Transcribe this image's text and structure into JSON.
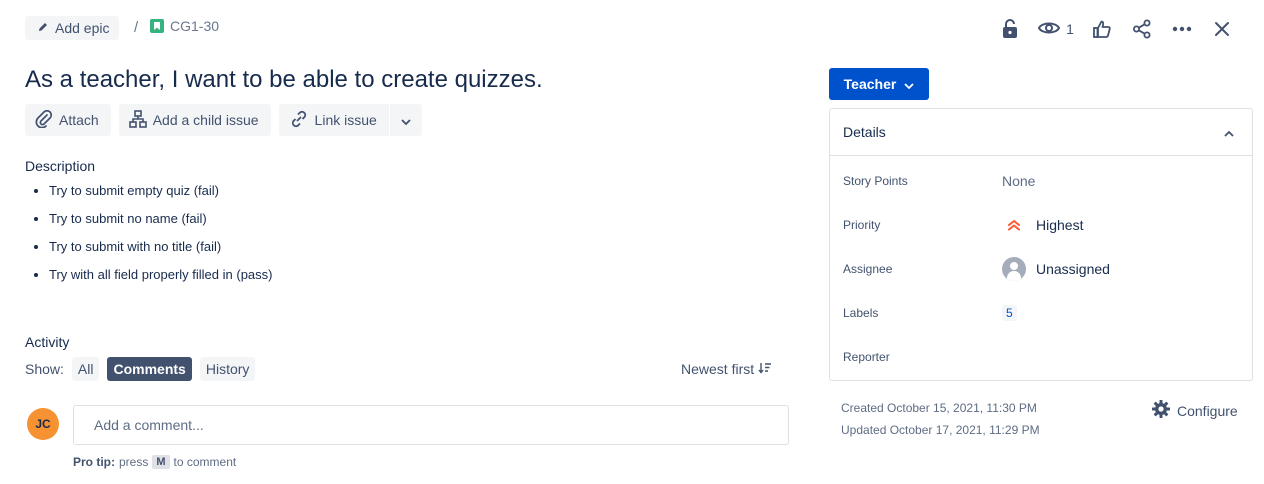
{
  "breadcrumb": {
    "epic_label": "Add epic",
    "separator": "/",
    "issue_key": "CG1-30"
  },
  "toolbar": {
    "watch_count": "1",
    "icons": [
      "unlock-icon",
      "eye-icon",
      "thumbs-up-icon",
      "share-icon",
      "more-icon",
      "close-icon"
    ]
  },
  "issue": {
    "title": "As a teacher, I want to be able to create quizzes."
  },
  "actions": {
    "attach": "Attach",
    "add_child": "Add a child issue",
    "link_issue": "Link issue"
  },
  "description": {
    "heading": "Description",
    "items": [
      "Try to submit empty quiz (fail)",
      "Try to submit no name (fail)",
      "Try to submit with no title (fail)",
      "Try with all field properly filled in (pass)"
    ]
  },
  "activity": {
    "heading": "Activity",
    "show_label": "Show:",
    "filters": [
      "All",
      "Comments",
      "History"
    ],
    "active_filter": "Comments",
    "sort_label": "Newest first",
    "avatar_initials": "JC",
    "comment_placeholder": "Add a comment...",
    "protip_prefix": "Pro tip:",
    "protip_press": "press",
    "protip_key": "M",
    "protip_suffix": "to comment"
  },
  "sidebar": {
    "status_label": "Teacher",
    "details_heading": "Details",
    "fields": {
      "story_points": {
        "label": "Story Points",
        "value": "None"
      },
      "priority": {
        "label": "Priority",
        "value": "Highest"
      },
      "assignee": {
        "label": "Assignee",
        "value": "Unassigned"
      },
      "labels": {
        "label": "Labels",
        "value": "5"
      },
      "reporter": {
        "label": "Reporter",
        "value": ""
      }
    },
    "created": "Created October 15, 2021, 11:30 PM",
    "updated": "Updated October 17, 2021, 11:29 PM",
    "configure_label": "Configure"
  },
  "colors": {
    "primary": "#0052cc",
    "priority_highest": "#ff5630",
    "avatar": "#f79232",
    "story_icon": "#36b37e"
  }
}
